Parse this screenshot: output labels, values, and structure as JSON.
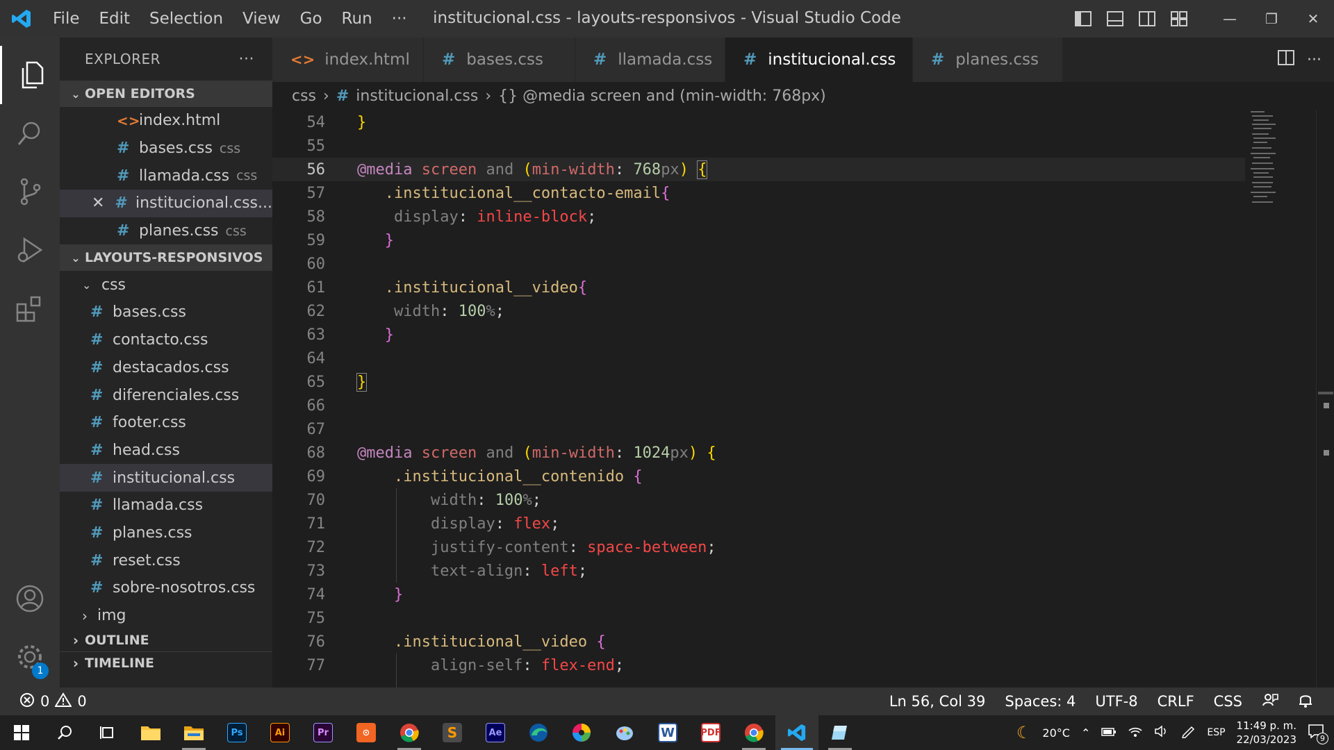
{
  "window": {
    "title": "institucional.css - layouts-responsivos - Visual Studio Code",
    "menu": [
      "File",
      "Edit",
      "Selection",
      "View",
      "Go",
      "Run",
      "···"
    ]
  },
  "sidebar": {
    "header": "EXPLORER",
    "more": "···",
    "open_editors_title": "OPEN EDITORS",
    "open_editors": [
      {
        "name": "index.html",
        "hint": "",
        "type": "html"
      },
      {
        "name": "bases.css",
        "hint": "css",
        "type": "css"
      },
      {
        "name": "llamada.css",
        "hint": "css",
        "type": "css"
      },
      {
        "name": "institucional.css...",
        "hint": "",
        "type": "css",
        "active": true
      },
      {
        "name": "planes.css",
        "hint": "css",
        "type": "css"
      }
    ],
    "project_title": "LAYOUTS-RESPONSIVOS",
    "folder_css": "css",
    "files": [
      "bases.css",
      "contacto.css",
      "destacados.css",
      "diferenciales.css",
      "footer.css",
      "head.css",
      "institucional.css",
      "llamada.css",
      "planes.css",
      "reset.css",
      "sobre-nosotros.css"
    ],
    "folder_img": "img",
    "outline": "OUTLINE",
    "timeline": "TIMELINE"
  },
  "tabs": [
    {
      "label": "index.html",
      "type": "html"
    },
    {
      "label": "bases.css",
      "type": "css"
    },
    {
      "label": "llamada.css",
      "type": "css"
    },
    {
      "label": "institucional.css",
      "type": "css",
      "active": true
    },
    {
      "label": "planes.css",
      "type": "css"
    }
  ],
  "breadcrumb": {
    "folder": "css",
    "file": "institucional.css",
    "symbol": "{} @media screen and (min-width: 768px)"
  },
  "editor": {
    "line_numbers": [
      "54",
      "55",
      "56",
      "57",
      "58",
      "59",
      "60",
      "61",
      "62",
      "63",
      "64",
      "65",
      "66",
      "67",
      "68",
      "69",
      "70",
      "71",
      "72",
      "73",
      "74",
      "75",
      "76",
      "77"
    ],
    "current_line": "56"
  },
  "status": {
    "errors": "0",
    "warnings": "0",
    "position": "Ln 56, Col 39",
    "spaces": "Spaces: 4",
    "encoding": "UTF-8",
    "eol": "CRLF",
    "language": "CSS"
  },
  "activity": {
    "badge": "1"
  },
  "taskbar": {
    "weather": "20°C",
    "lang": "ESP",
    "time": "11:49 p. m.",
    "date": "22/03/2023",
    "notifications": "9"
  },
  "colors": {
    "accent": "#007acc",
    "css_icon": "#519aba",
    "html_icon": "#e37933"
  }
}
